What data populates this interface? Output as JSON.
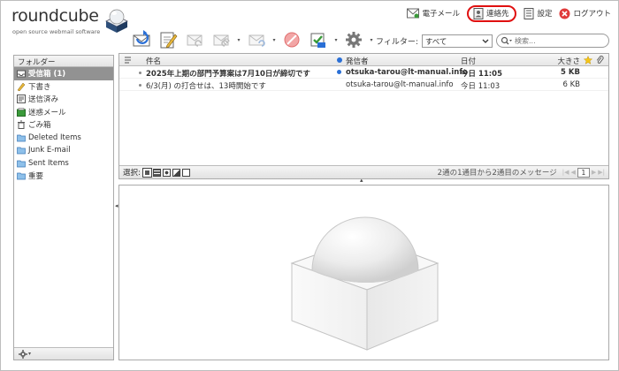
{
  "app": {
    "logo_text": "roundcube",
    "logo_subtitle": "open source webmail software"
  },
  "topnav": {
    "mail": "電子メール",
    "contacts": "連絡先",
    "settings": "設定",
    "logout": "ログアウト"
  },
  "toolbar": {
    "icons": [
      "refresh-icon",
      "compose-icon",
      "reply-icon",
      "reply-all-icon",
      "forward-icon",
      "delete-icon",
      "mark-icon",
      "more-icon"
    ]
  },
  "filter": {
    "label": "フィルター:",
    "selected": "すべて"
  },
  "search": {
    "placeholder": "検索..."
  },
  "folders": {
    "header": "フォルダー",
    "items": [
      {
        "label": "受信箱 (1)",
        "icon": "inbox-icon",
        "selected": true
      },
      {
        "label": "下書き",
        "icon": "drafts-icon",
        "selected": false
      },
      {
        "label": "送信済み",
        "icon": "sent-icon",
        "selected": false
      },
      {
        "label": "迷惑メール",
        "icon": "junk-icon",
        "selected": false
      },
      {
        "label": "ごみ箱",
        "icon": "trash-icon",
        "selected": false
      },
      {
        "label": "Deleted Items",
        "icon": "folder-icon",
        "selected": false
      },
      {
        "label": "Junk E-mail",
        "icon": "folder-icon",
        "selected": false
      },
      {
        "label": "Sent Items",
        "icon": "folder-icon",
        "selected": false
      },
      {
        "label": "重要",
        "icon": "folder-icon",
        "selected": false
      }
    ]
  },
  "messages": {
    "columns": {
      "subject": "件名",
      "from": "発信者",
      "date": "日付",
      "size": "大きさ"
    },
    "rows": [
      {
        "subject": "2025年上期の部門予算案は7月10日が締切です",
        "from": "otsuka-tarou@lt-manual.info",
        "date": "今日 11:05",
        "size": "5 KB",
        "unread": true
      },
      {
        "subject": "6/3(月) の打合せは、13時開始です",
        "from": "otsuka-tarou@lt-manual.info",
        "date": "今日 11:03",
        "size": "6 KB",
        "unread": false
      }
    ],
    "footer": {
      "select_label": "選択:",
      "count_text": "2通の1通目から2通目のメッセージ",
      "page": "1"
    }
  },
  "colors": {
    "selected_folder_bg": "#929292",
    "contacts_highlight": "#e01010",
    "unread_dot": "#2a6fd6"
  }
}
